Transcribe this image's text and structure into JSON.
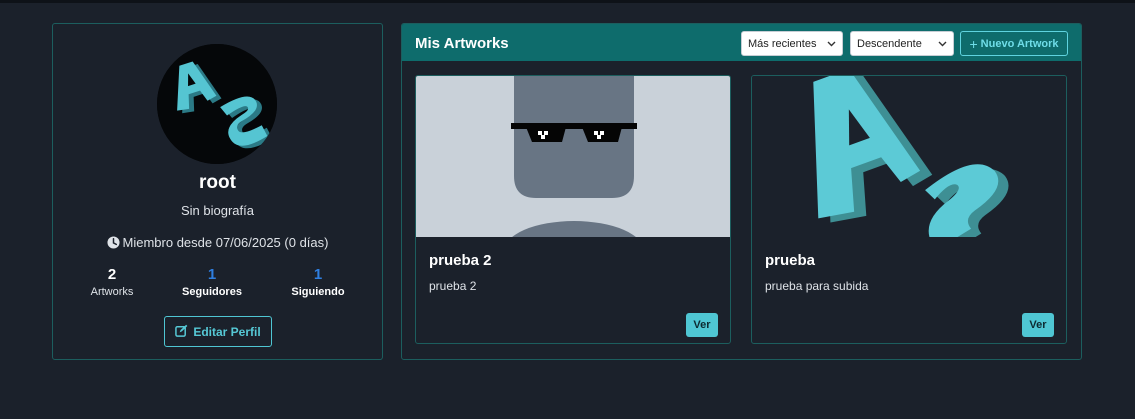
{
  "profile": {
    "username": "root",
    "bio": "Sin biografía",
    "member_since": "Miembro desde 07/06/2025 (0 días)",
    "stats": [
      {
        "value": "2",
        "label": "Artworks"
      },
      {
        "value": "1",
        "label": "Seguidores"
      },
      {
        "value": "1",
        "label": "Siguiendo"
      }
    ],
    "edit_label": "Editar Perfil",
    "avatar_icon": "as-logo-avatar"
  },
  "artworks": {
    "title": "Mis Artworks",
    "sort_field": "Más recientes",
    "sort_order": "Descendente",
    "new_label": "Nuevo Artwork",
    "items": [
      {
        "title": "prueba 2",
        "description": "prueba 2",
        "action": "Ver",
        "thumb": "person-with-sunglasses"
      },
      {
        "title": "prueba",
        "description": "prueba para subida",
        "action": "Ver",
        "thumb": "as-logo"
      }
    ]
  },
  "colors": {
    "background": "#1b212b",
    "accent": "#4fc6d3",
    "header": "#0e6c6c",
    "link_blue": "#2f7fe0"
  }
}
